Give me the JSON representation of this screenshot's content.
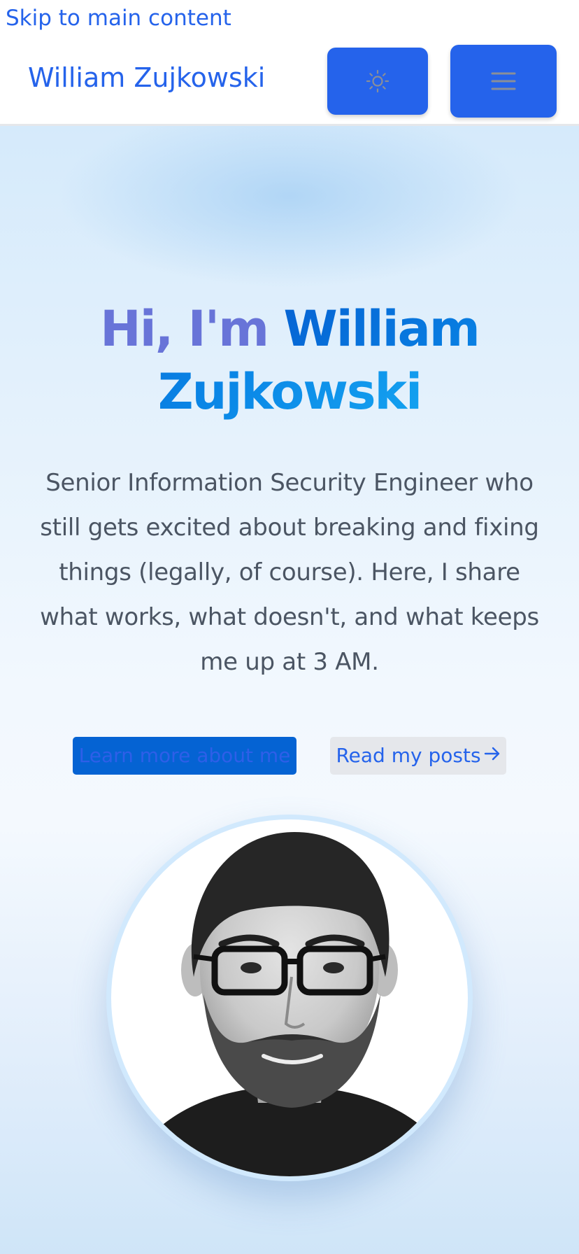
{
  "skip_link": "Skip to main content",
  "header": {
    "site_title": "William Zujkowski",
    "theme_toggle_icon": "sun-icon",
    "menu_icon": "hamburger-menu-icon",
    "accent_color": "#2563eb"
  },
  "hero": {
    "greeting": "Hi, I'm",
    "name": "William Zujkowski",
    "description": "Senior Information Security Engineer who still gets excited about breaking and fixing things (legally, of course). Here, I share what works, what doesn't, and what keeps me up at 3 AM.",
    "primary_cta": "Learn more about me",
    "secondary_cta": "Read my posts",
    "secondary_cta_icon": "arrow-right-icon",
    "portrait_icon": "profile-photo"
  }
}
